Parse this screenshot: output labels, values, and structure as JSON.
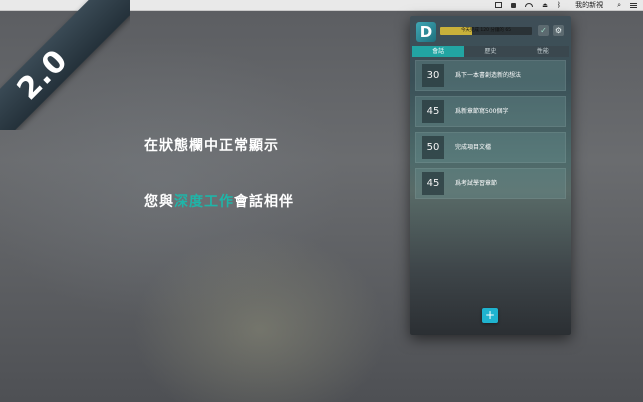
{
  "menubar": {
    "app_menu_label": "我的新視"
  },
  "ribbon": {
    "version": "2.0"
  },
  "captions": {
    "line1": "在狀態欄中正常顯示",
    "line2_before": "您與",
    "line2_highlight": "深度工作",
    "line2_after": "會話相伴"
  },
  "panel": {
    "logo_letter": "D",
    "progress_text": "今天完成 120 分鐘的 65",
    "progress_fraction": 0.35,
    "tabs": [
      {
        "label": "會話",
        "active": true
      },
      {
        "label": "歷史",
        "active": false
      },
      {
        "label": "性能",
        "active": false
      }
    ],
    "sessions": [
      {
        "minutes": "30",
        "title": "爲下一本書創造新的想法"
      },
      {
        "minutes": "45",
        "title": "爲新章節寫500個字"
      },
      {
        "minutes": "50",
        "title": "完成項目文檔"
      },
      {
        "minutes": "45",
        "title": "爲考試學習章節"
      }
    ],
    "add_label": "+"
  },
  "colors": {
    "accent": "#22a5a3",
    "highlight": "#1fb5a8",
    "progress": "#c9b13a",
    "add_button": "#1fb3cf"
  },
  "icons": [
    "app-status-icon",
    "lock-icon",
    "wifi-icon",
    "eject-icon",
    "bluetooth-icon",
    "search-icon",
    "menu-list-icon",
    "check-icon",
    "gear-icon",
    "plus-icon"
  ]
}
